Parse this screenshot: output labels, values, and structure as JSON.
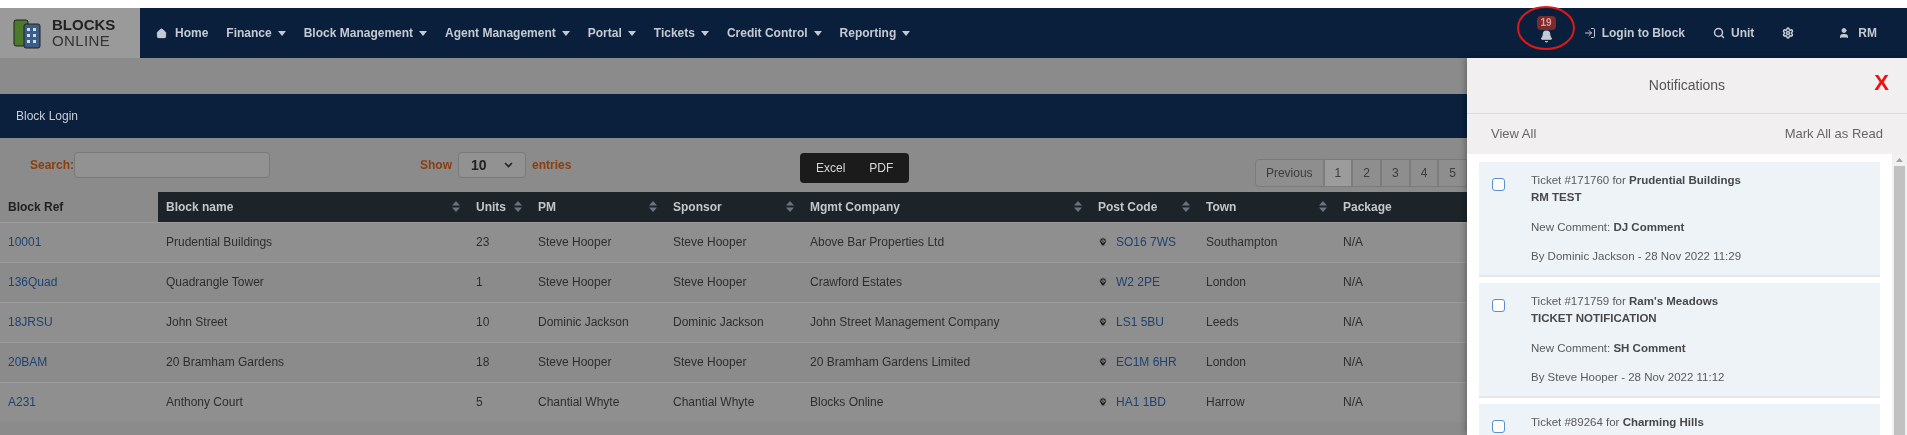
{
  "logo": {
    "line1": "BLOCKS",
    "line2": "ONLINE"
  },
  "nav": {
    "items": [
      {
        "label": "Home",
        "kind": "home"
      },
      {
        "label": "Finance",
        "kind": "dropdown"
      },
      {
        "label": "Block Management",
        "kind": "dropdown"
      },
      {
        "label": "Agent Management",
        "kind": "dropdown"
      },
      {
        "label": "Portal",
        "kind": "dropdown"
      },
      {
        "label": "Tickets",
        "kind": "dropdown"
      },
      {
        "label": "Credit Control",
        "kind": "dropdown"
      },
      {
        "label": "Reporting",
        "kind": "dropdown"
      }
    ],
    "notification_count": "19",
    "login_to_block": "Login to Block",
    "unit_search": "Unit",
    "user": "RM"
  },
  "panel_title": "Block Login",
  "controls": {
    "search_label": "Search:",
    "show_label": "Show",
    "show_value": "10",
    "entries_label": "entries",
    "export_buttons": [
      "Excel",
      "PDF"
    ],
    "pagination": [
      {
        "label": "Previous",
        "selected": false
      },
      {
        "label": "1",
        "selected": true
      },
      {
        "label": "2",
        "selected": false
      },
      {
        "label": "3",
        "selected": false
      },
      {
        "label": "4",
        "selected": false
      },
      {
        "label": "5",
        "selected": false
      }
    ]
  },
  "table": {
    "columns": [
      {
        "label": "Block Ref",
        "sorted": true
      },
      {
        "label": "Block name",
        "sorted": false
      },
      {
        "label": "Units",
        "sorted": false
      },
      {
        "label": "PM",
        "sorted": false
      },
      {
        "label": "Sponsor",
        "sorted": false
      },
      {
        "label": "Mgmt Company",
        "sorted": false
      },
      {
        "label": "Post Code",
        "sorted": false
      },
      {
        "label": "Town",
        "sorted": false
      },
      {
        "label": "Package",
        "sorted": false
      }
    ],
    "rows": [
      [
        "10001",
        "Prudential Buildings",
        "23",
        "Steve Hooper",
        "Steve Hooper",
        "Above Bar Properties Ltd",
        "SO16 7WS",
        "Southampton",
        "N/A"
      ],
      [
        "136Quad",
        "Quadrangle Tower",
        "1",
        "Steve Hooper",
        "Steve Hooper",
        "Crawford Estates",
        "W2 2PE",
        "London",
        "N/A"
      ],
      [
        "18JRSU",
        "John Street",
        "10",
        "Dominic Jackson",
        "Dominic Jackson",
        "John Street Management Company",
        "LS1 5BU",
        "Leeds",
        "N/A"
      ],
      [
        "20BAM",
        "20 Bramham Gardens",
        "18",
        "Steve Hooper",
        "Steve Hooper",
        "20 Bramham Gardens Limited",
        "EC1M 6HR",
        "London",
        "N/A"
      ],
      [
        "A231",
        "Anthony Court",
        "5",
        "Chantial Whyte",
        "Chantial Whyte",
        "Blocks Online",
        "HA1 1BD",
        "Harrow",
        "N/A"
      ]
    ]
  },
  "notifications": {
    "title": "Notifications",
    "close": "X",
    "view_all": "View All",
    "mark_all_read": "Mark All as Read",
    "items": [
      {
        "ticket": "Ticket #171760 for **Prudential Buildings**",
        "subject": "RM TEST",
        "comment": "New Comment: **DJ Comment**",
        "by": "By Dominic Jackson - 28 Nov 2022 11:29",
        "checked": false
      },
      {
        "ticket": "Ticket #171759 for **Ram's Meadows**",
        "subject": "TICKET NOTIFICATION",
        "comment": "New Comment: **SH Comment**",
        "by": "By Steve Hooper - 28 Nov 2022 11:12",
        "checked": false
      },
      {
        "ticket": "Ticket #89264 for **Charming Hills**",
        "checked": false
      }
    ]
  }
}
